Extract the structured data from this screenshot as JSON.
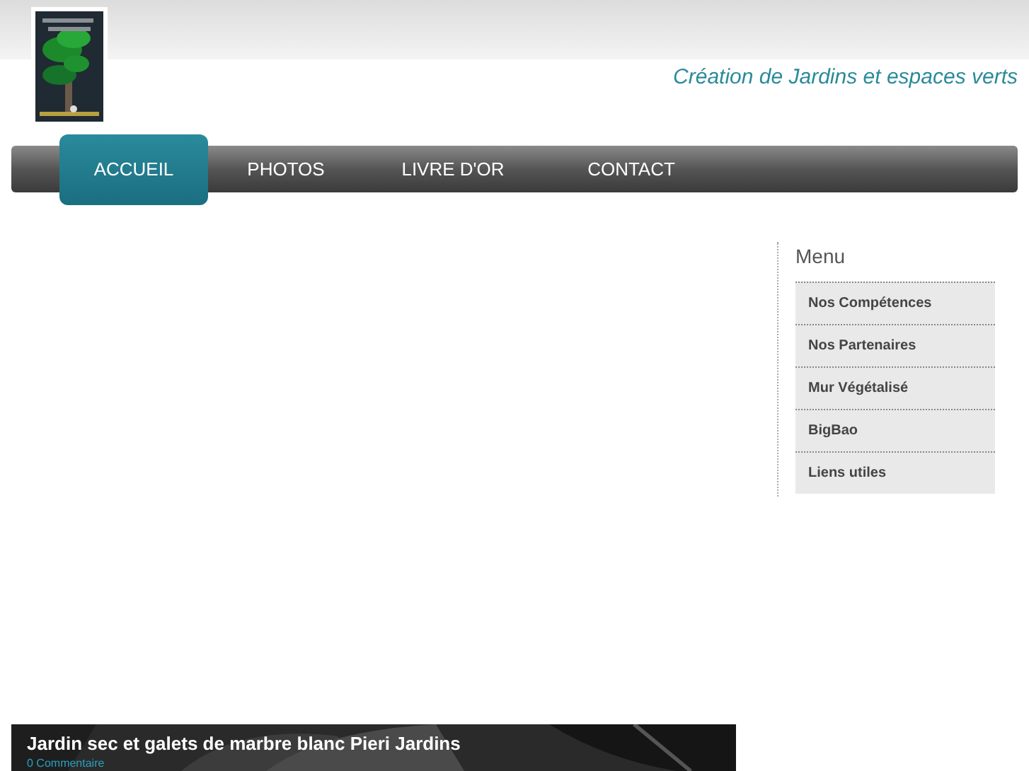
{
  "header": {
    "tagline": "Création de Jardins et espaces verts"
  },
  "nav": [
    {
      "label": "ACCUEIL",
      "selected": true
    },
    {
      "label": "PHOTOS",
      "selected": false
    },
    {
      "label": "LIVRE D'OR",
      "selected": false
    },
    {
      "label": "CONTACT",
      "selected": false
    }
  ],
  "sidebar": {
    "title": "Menu",
    "items": [
      "Nos Compétences",
      "Nos Partenaires",
      "Mur Végétalisé",
      "BigBao",
      "Liens utiles"
    ]
  },
  "post": {
    "title": "Jardin sec et galets de marbre blanc Pieri Jardins",
    "comments": "0 Commentaire"
  }
}
